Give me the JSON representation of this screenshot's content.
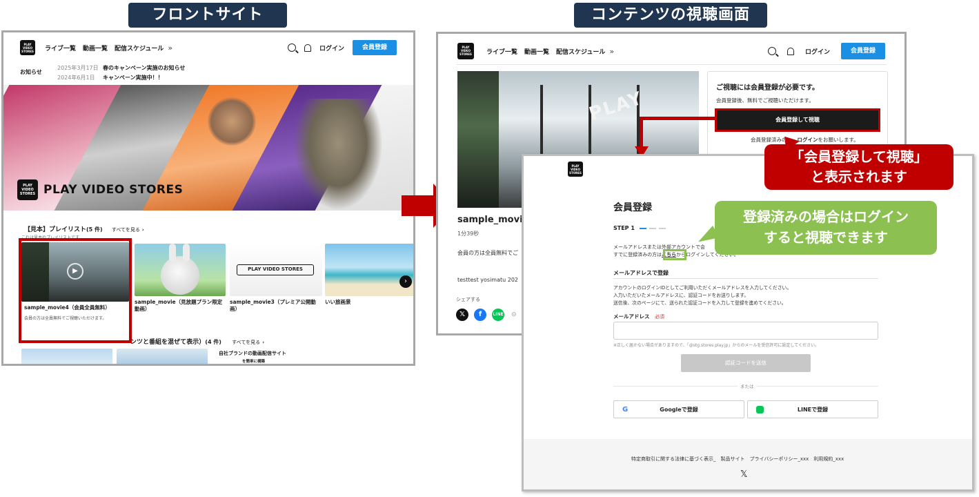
{
  "labels": {
    "front_site": "フロントサイト",
    "content_view": "コンテンツの視聴画面"
  },
  "header": {
    "logo": "PLAY VIDEO STORES",
    "nav": [
      "ライブ一覧",
      "動画一覧",
      "配信スケジュール"
    ],
    "more": "»",
    "login": "ログイン",
    "register": "会員登録"
  },
  "front": {
    "news_label": "お知らせ",
    "news": [
      {
        "date": "2025年3月17日",
        "text": "春のキャンペーン実施のお知らせ"
      },
      {
        "date": "2024年6月1日",
        "text": "キャンペーン実施中！！"
      }
    ],
    "hero_brand": "PLAY VIDEO STORES",
    "playlist_title": "【見本】プレイリスト",
    "playlist_count": "(5 件)",
    "see_all": "すべてを見る",
    "playlist_desc": "これは見本のプレイリストです",
    "cards": [
      {
        "title": "sample_movie4（会員全員無料）",
        "sub": "会員の方は全員無料でご視聴いただけます。"
      },
      {
        "title": "sample_movie（見放題プラン限定動画）",
        "sub": ""
      },
      {
        "title": "sample_movie3（プレミア公開動画）",
        "sub": ""
      },
      {
        "title": "いい旅画景",
        "sub": ""
      }
    ],
    "card3_brand": "PLAY VIDEO STORES",
    "section2_title": "ンツと番組を混ぜて表示）",
    "section2_count": "(4 件)",
    "section2_see_all": "すべてを見る",
    "promo_line1": "自社ブランドの動画配信サイト",
    "promo_line2": "を簡単に構築"
  },
  "content": {
    "title": "sample_movie",
    "duration": "1分39秒",
    "desc": "会員の方は全員無料でご",
    "author": "testtest yosimatu 202",
    "share_label": "シェアする",
    "video_brand": "PLAY",
    "gate_title": "ご視聴には会員登録が必要です。",
    "gate_sub": "会員登録後、無料でご視聴いただけます。",
    "gate_button": "会員登録して視聴",
    "gate_login_note_a": "会員登録済みの",
    "gate_login_link": "ログイン",
    "gate_login_note_b": "をお願いします。"
  },
  "callouts": {
    "red_line1": "「会員登録して視聴」",
    "red_line2": "と表示されます",
    "green_line1": "登録済みの場合はログイン",
    "green_line2": "すると視聴できます"
  },
  "signup": {
    "title": "会員登録",
    "step": "STEP 1",
    "intro1": "メールアドレスまたは外部アカウントで会",
    "intro2a": "すでに登録済みの方は",
    "intro2_link": "こちら",
    "intro2b": "からログインしてください。",
    "email_section": "メールアドレスで登録",
    "email_desc1": "アカウントのログインIDとしてご利用いただくメールアドレスを入力してください。",
    "email_desc2": "入力いただいたメールアドレスに、認証コードをお送りします。",
    "email_desc3": "送信後、次のページにて、送られた認証コードを入力して登録を進めてください。",
    "email_label": "メールアドレス",
    "required": "必須",
    "email_note": "※正しく届かない場合がありますので、「@stg.stores.play.jp」からのメールを受信許可に設定してください。",
    "send_code": "認証コードを送信",
    "or": "または",
    "google": "Googleで登録",
    "line": "LINEで登録",
    "footer_links": "特定商取引に関する法律に基づく表示_　製品サイト　プライバシーポリシー_xxx　利用規約_xxx",
    "footer_x": "𝕏"
  },
  "colors": {
    "brand_blue": "#1a8fe3",
    "label_navy": "#1f3550",
    "highlight_red": "#c00000",
    "callout_green": "#8cc152"
  }
}
